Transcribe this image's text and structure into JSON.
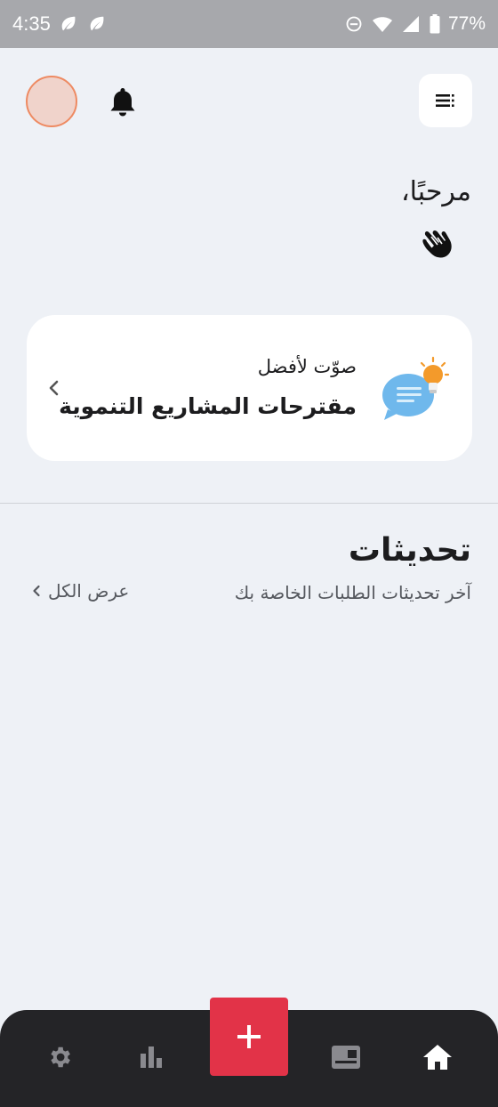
{
  "status_bar": {
    "time": "4:35",
    "battery": "77%"
  },
  "header": {
    "avatar": "avatar",
    "notification_icon": "bell-icon",
    "menu_icon": "menu-icon"
  },
  "greeting": {
    "text": "مرحبًا،",
    "emoji_icon": "waving-hand-icon"
  },
  "promo_card": {
    "subtitle": "صوّت لأفضل",
    "title": "مقترحات المشاريع التنموية",
    "icon": "idea-chat-icon"
  },
  "updates": {
    "title": "تحديثات",
    "subtitle": "آخر تحديثات الطلبات الخاصة بك",
    "view_all": "عرض الكل"
  },
  "bottom_nav": {
    "items": [
      "settings-icon",
      "stats-icon",
      "add-icon",
      "news-icon",
      "home-icon"
    ],
    "accent": "#e23348",
    "background": "#242427"
  }
}
